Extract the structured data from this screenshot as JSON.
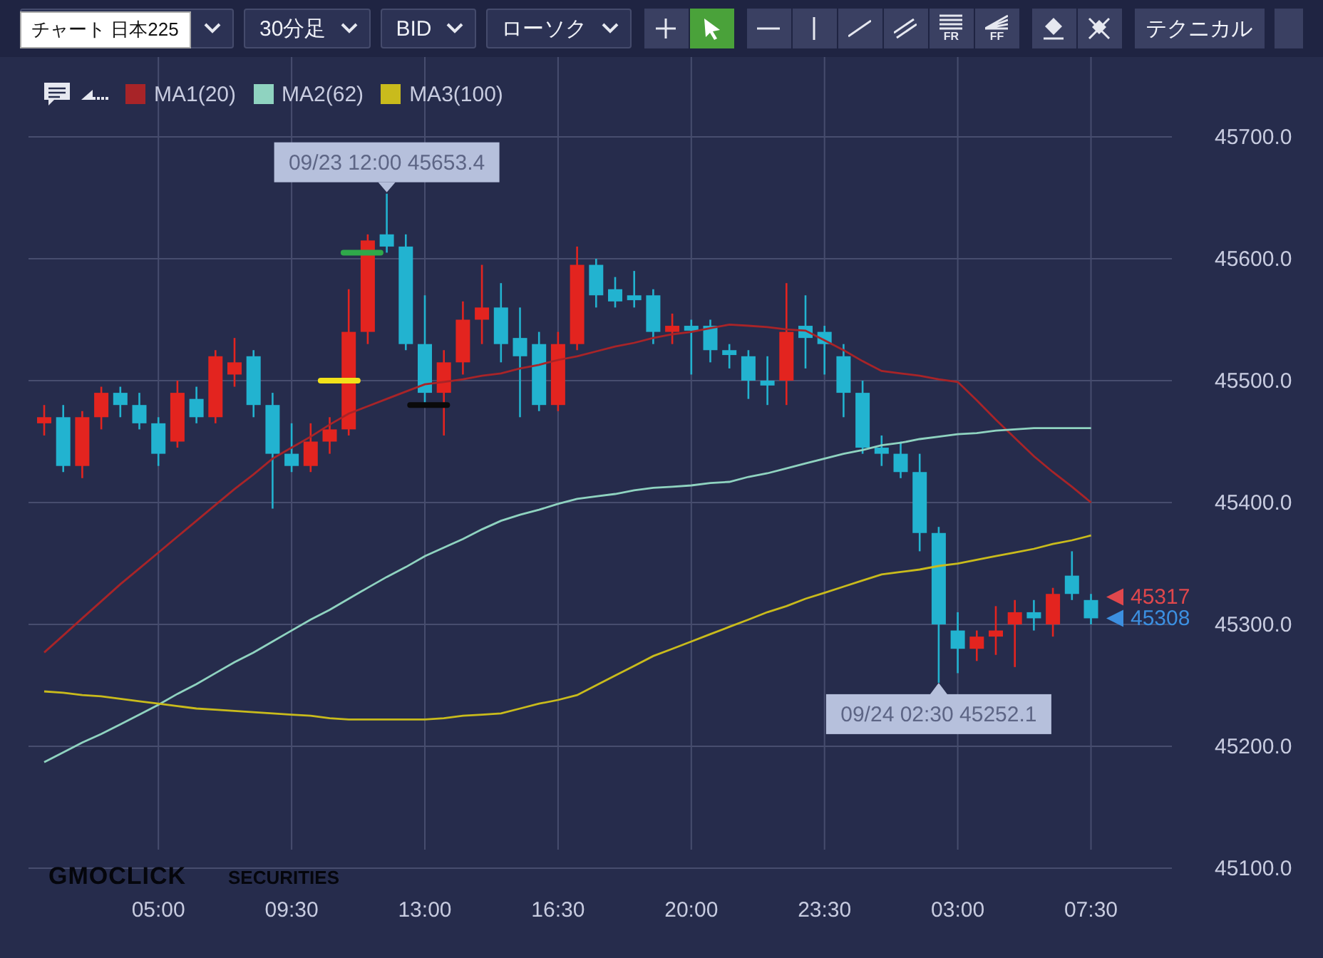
{
  "toolbar": {
    "symbol_tooltip": "チャート 日本225",
    "dropdowns": [
      {
        "label": "30分足"
      },
      {
        "label": "BID"
      },
      {
        "label": "ローソク"
      }
    ],
    "tool_groups": [
      [
        {
          "kind": "crosshair",
          "selected": false
        },
        {
          "kind": "cursor",
          "selected": true
        }
      ],
      [
        {
          "kind": "hline",
          "selected": false
        },
        {
          "kind": "vline",
          "selected": false
        },
        {
          "kind": "trend",
          "selected": false
        },
        {
          "kind": "parallel",
          "selected": false
        },
        {
          "kind": "fibo",
          "label": "FR",
          "selected": false
        },
        {
          "kind": "fan",
          "label": "FF",
          "selected": false
        }
      ],
      [
        {
          "kind": "eraser",
          "selected": false
        },
        {
          "kind": "eraseall",
          "selected": false
        }
      ]
    ],
    "technical_button": "テクニカル"
  },
  "chart": {
    "logo": {
      "brand": "GMOCLICK",
      "suffix": "SECURITIES"
    },
    "drawings": [
      {
        "color": "#2fa84a"
      },
      {
        "color": "#f2e21a"
      },
      {
        "color": "#0a0a0a"
      }
    ],
    "price_markers": [
      {
        "text": "45317",
        "color": "#e0474c"
      },
      {
        "text": "45308",
        "color": "#3c8fe0"
      }
    ],
    "chart_data": {
      "type": "candlestick",
      "categories": [
        null,
        null,
        null,
        null,
        null,
        null,
        "05:00",
        null,
        null,
        null,
        null,
        null,
        null,
        "09:30",
        null,
        null,
        null,
        null,
        null,
        null,
        "13:00",
        null,
        null,
        null,
        null,
        null,
        null,
        "16:30",
        null,
        null,
        null,
        null,
        null,
        null,
        "20:00",
        null,
        null,
        null,
        null,
        null,
        null,
        "23:30",
        null,
        null,
        null,
        null,
        null,
        null,
        "03:00",
        null,
        null,
        null,
        null,
        null,
        null,
        "07:30"
      ],
      "ohlc": [
        [
          45465,
          45480,
          45455,
          45470
        ],
        [
          45470,
          45480,
          45425,
          45430
        ],
        [
          45430,
          45475,
          45420,
          45470
        ],
        [
          45470,
          45495,
          45460,
          45490
        ],
        [
          45490,
          45495,
          45470,
          45480
        ],
        [
          45480,
          45490,
          45460,
          45465
        ],
        [
          45465,
          45470,
          45430,
          45440
        ],
        [
          45450,
          45500,
          45445,
          45490
        ],
        [
          45485,
          45495,
          45465,
          45470
        ],
        [
          45470,
          45525,
          45465,
          45520
        ],
        [
          45505,
          45535,
          45495,
          45515
        ],
        [
          45520,
          45525,
          45470,
          45480
        ],
        [
          45480,
          45490,
          45395,
          45440
        ],
        [
          45440,
          45465,
          45425,
          45430
        ],
        [
          45430,
          45465,
          45425,
          45450
        ],
        [
          45450,
          45470,
          45440,
          45460
        ],
        [
          45460,
          45575,
          45455,
          45540
        ],
        [
          45540,
          45620,
          45530,
          45615
        ],
        [
          45620,
          45653.4,
          45605,
          45610
        ],
        [
          45610,
          45620,
          45525,
          45530
        ],
        [
          45530,
          45570,
          45480,
          45490
        ],
        [
          45490,
          45525,
          45455,
          45515
        ],
        [
          45515,
          45565,
          45505,
          45550
        ],
        [
          45550,
          45595,
          45530,
          45560
        ],
        [
          45560,
          45580,
          45515,
          45530
        ],
        [
          45535,
          45560,
          45470,
          45520
        ],
        [
          45530,
          45540,
          45475,
          45480
        ],
        [
          45480,
          45540,
          45475,
          45530
        ],
        [
          45530,
          45610,
          45525,
          45595
        ],
        [
          45595,
          45600,
          45560,
          45570
        ],
        [
          45575,
          45585,
          45560,
          45565
        ],
        [
          45570,
          45590,
          45560,
          45566
        ],
        [
          45570,
          45575,
          45530,
          45540
        ],
        [
          45540,
          45555,
          45530,
          45545
        ],
        [
          45545,
          45550,
          45505,
          45541
        ],
        [
          45545,
          45550,
          45515,
          45525
        ],
        [
          45525,
          45530,
          45510,
          45521
        ],
        [
          45520,
          45525,
          45485,
          45500
        ],
        [
          45500,
          45520,
          45480,
          45496
        ],
        [
          45500,
          45580,
          45480,
          45540
        ],
        [
          45545,
          45570,
          45510,
          45535
        ],
        [
          45540,
          45545,
          45505,
          45530
        ],
        [
          45520,
          45530,
          45470,
          45490
        ],
        [
          45490,
          45500,
          45440,
          45445
        ],
        [
          45445,
          45455,
          45430,
          45440
        ],
        [
          45440,
          45450,
          45420,
          45425
        ],
        [
          45425,
          45440,
          45360,
          45375
        ],
        [
          45375,
          45380,
          45252.1,
          45300
        ],
        [
          45295,
          45310,
          45260,
          45280
        ],
        [
          45280,
          45295,
          45270,
          45290
        ],
        [
          45290,
          45315,
          45275,
          45295
        ],
        [
          45300,
          45320,
          45265,
          45310
        ],
        [
          45310,
          45320,
          45295,
          45305
        ],
        [
          45300,
          45330,
          45290,
          45325
        ],
        [
          45340,
          45360,
          45320,
          45325
        ],
        [
          45320,
          45325,
          45300,
          45305
        ]
      ],
      "series": [
        {
          "name": "MA1(20)",
          "type": "line",
          "color": "#a82428",
          "values": [
            45277,
            45291,
            45305,
            45319,
            45333,
            45346,
            45359,
            45372,
            45385,
            45398,
            45411,
            45423,
            45436,
            45445,
            45454,
            45464,
            45473,
            45479,
            45485,
            45491,
            45497,
            45499,
            45501,
            45504,
            45506,
            45510,
            45513,
            45517,
            45520,
            45524,
            45528,
            45531,
            45535,
            45538,
            45540,
            45543,
            45546,
            45545,
            45544,
            45542,
            45541,
            45533,
            45525,
            45516,
            45508,
            45506,
            45504,
            45501,
            45499,
            45484,
            45468,
            45453,
            45438,
            45425,
            45413,
            45400
          ]
        },
        {
          "name": "MA2(62)",
          "type": "line",
          "color": "#8fd3c0",
          "values": [
            45187,
            45195,
            45203,
            45210,
            45218,
            45226,
            45234,
            45243,
            45251,
            45260,
            45269,
            45277,
            45286,
            45295,
            45304,
            45312,
            45321,
            45330,
            45339,
            45347,
            45356,
            45363,
            45370,
            45378,
            45385,
            45390,
            45394,
            45399,
            45403,
            45405,
            45407,
            45410,
            45412,
            45413,
            45414,
            45416,
            45417,
            45421,
            45424,
            45428,
            45432,
            45436,
            45440,
            45443,
            45447,
            45449,
            45452,
            45454,
            45456,
            45457,
            45459,
            45460,
            45461,
            45461,
            45461,
            45461
          ]
        },
        {
          "name": "MA3(100)",
          "type": "line",
          "color": "#c9bb1c",
          "values": [
            45245,
            45244,
            45242,
            45241,
            45239,
            45237,
            45235,
            45233,
            45231,
            45230,
            45229,
            45228,
            45227,
            45226,
            45225,
            45223,
            45222,
            45222,
            45222,
            45222,
            45222,
            45223,
            45225,
            45226,
            45227,
            45231,
            45235,
            45238,
            45242,
            45250,
            45258,
            45266,
            45274,
            45280,
            45286,
            45292,
            45298,
            45304,
            45310,
            45315,
            45321,
            45326,
            45331,
            45336,
            45341,
            45343,
            45345,
            45348,
            45350,
            45353,
            45356,
            45359,
            45362,
            45366,
            45369,
            45373
          ]
        }
      ],
      "ylim": [
        45100,
        45700
      ],
      "grid": true,
      "yticks": [
        {
          "value": 45700,
          "label": "45700.0"
        },
        {
          "value": 45600,
          "label": "45600.0"
        },
        {
          "value": 45500,
          "label": "45500.0"
        },
        {
          "value": 45400,
          "label": "45400.0"
        },
        {
          "value": 45300,
          "label": "45300.0"
        },
        {
          "value": 45200,
          "label": "45200.0"
        },
        {
          "value": 45100,
          "label": "45100.0"
        }
      ],
      "annotations": [
        "09/23 12:00 45653.4",
        "09/24 02:30 45252.1"
      ]
    }
  }
}
